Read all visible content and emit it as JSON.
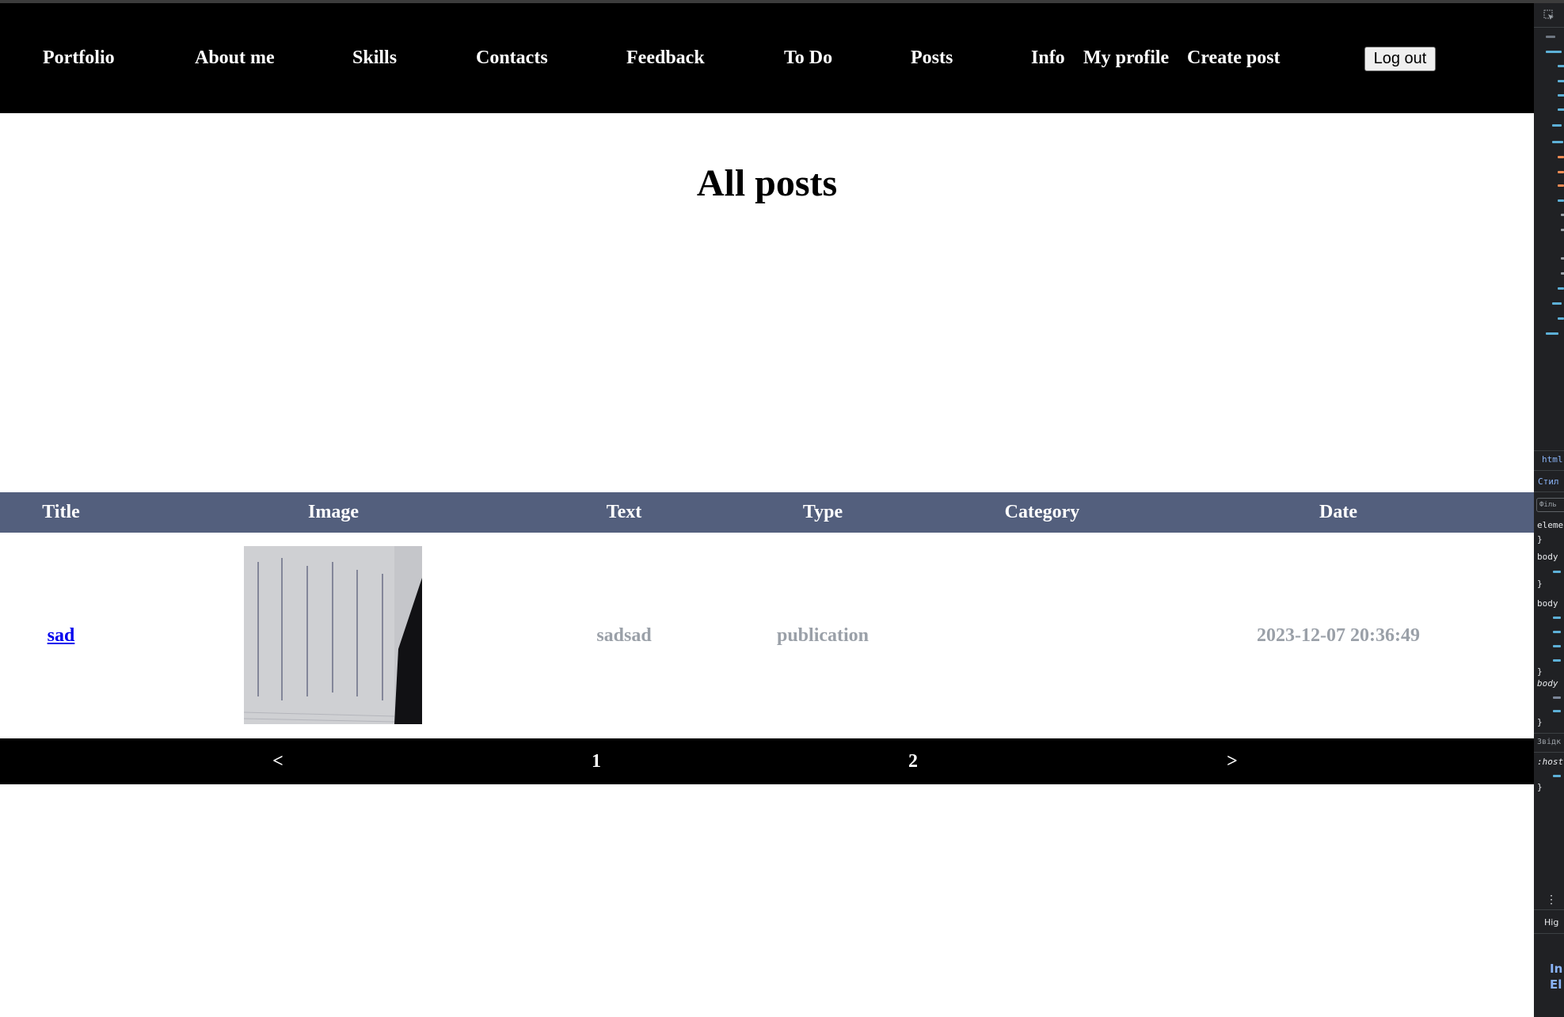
{
  "nav": {
    "links": [
      "Portfolio",
      "About me",
      "Skills",
      "Contacts",
      "Feedback",
      "To Do",
      "Posts",
      "Info",
      "My profile",
      "Create post"
    ],
    "logout_label": "Log out"
  },
  "page_title": "All posts",
  "table": {
    "headers": [
      "Title",
      "Image",
      "Text",
      "Type",
      "Category",
      "Date"
    ],
    "rows": [
      {
        "title": "sad",
        "text": "sadsad",
        "type": "publication",
        "category": "",
        "date": "2023-12-07 20:36:49"
      }
    ]
  },
  "pagination": {
    "prev": "<",
    "pages": [
      "1",
      "2"
    ],
    "next": ">"
  },
  "devtools": {
    "tab_html": "html",
    "tab_styles": "Стил",
    "filter_placeholder": "Філь",
    "rules": [
      "eleme",
      "body",
      "body",
      "body"
    ],
    "source_label": "Звідк",
    "host_rule": ":host",
    "highlight_label": "Hig",
    "more_label": "In\nEl"
  },
  "colors": {
    "nav_bg": "#000000",
    "table_header_bg": "#535f7d",
    "muted_text": "#9aa0a8",
    "link": "#0000ee"
  }
}
